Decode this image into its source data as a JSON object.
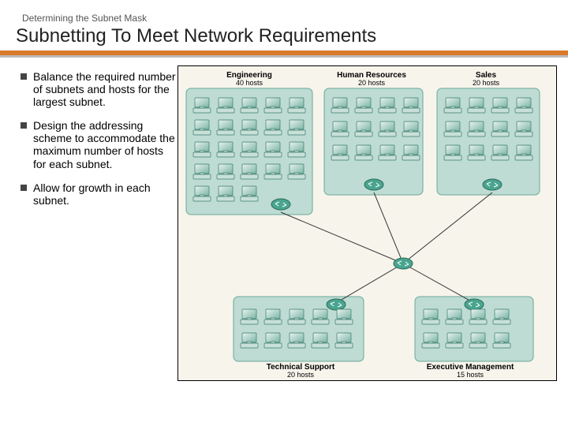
{
  "superhead": "Determining the Subnet  Mask",
  "title": "Subnetting To Meet Network Requirements",
  "bullets": [
    "Balance the required number of subnets and hosts for the largest subnet.",
    "Design the addressing scheme to accommodate the maximum number of hosts for each subnet.",
    "Allow for growth in each subnet."
  ],
  "departments": [
    {
      "name": "Engineering",
      "hosts": "40 hosts"
    },
    {
      "name": "Human Resources",
      "hosts": "20 hosts"
    },
    {
      "name": "Sales",
      "hosts": "20 hosts"
    },
    {
      "name": "Technical Support",
      "hosts": "20 hosts"
    },
    {
      "name": "Executive Management",
      "hosts": "15 hosts"
    }
  ]
}
